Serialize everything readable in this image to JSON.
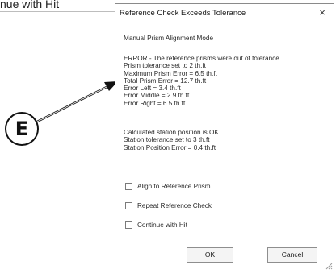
{
  "background": {
    "partial_label": "nue with Hit"
  },
  "callout": {
    "letter": "E"
  },
  "dialog": {
    "title": "Reference Check Exceeds Tolerance",
    "close_label": "×",
    "mode_line": "Manual Prism Alignment Mode",
    "error_lines": [
      "ERROR - The reference prisms were out of tolerance",
      "Prism tolerance set to 2 th.ft",
      "Maximum Prism Error = 6.5 th.ft",
      "Total Prism Error = 12.7 th.ft",
      "Error Left = 3.4 th.ft",
      "Error Middle = 2.9 th.ft",
      "Error Right = 6.5 th.ft"
    ],
    "calc_lines": [
      "Calculated station position is OK.",
      "Station tolerance set to 3 th.ft",
      "Station Position Error = 0.4 th.ft"
    ],
    "checkboxes": [
      {
        "label": "Align to Reference Prism",
        "checked": false
      },
      {
        "label": "Repeat Reference Check",
        "checked": false
      },
      {
        "label": "Continue with Hit",
        "checked": false
      }
    ],
    "ok_label": "OK",
    "cancel_label": "Cancel"
  },
  "colors": {
    "dialog_border": "#8a8a8a",
    "button_face": "#f4f4f4",
    "text": "#2a2a2a"
  }
}
